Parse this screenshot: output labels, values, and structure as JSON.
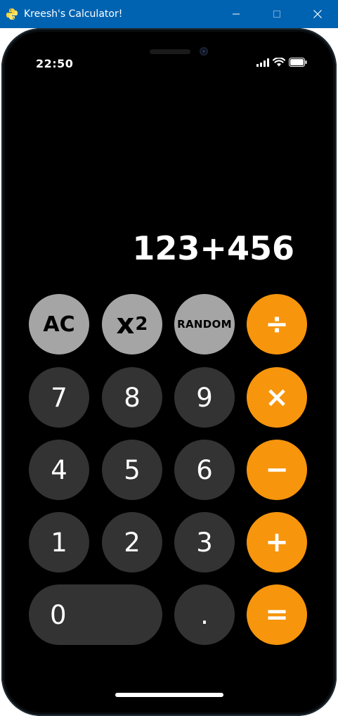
{
  "window": {
    "title": "Kreesh's Calculator!",
    "app_icon": "python-icon",
    "controls": [
      "minimize-icon",
      "maximize-icon",
      "close-icon"
    ]
  },
  "status_bar": {
    "time": "22:50",
    "icons": [
      "signal-icon",
      "wifi-icon",
      "battery-icon"
    ]
  },
  "display": {
    "expression": "123+456"
  },
  "keys": {
    "ac": "AC",
    "square": "x",
    "square_sub": "2",
    "random": "RANDOM",
    "divide": "÷",
    "seven": "7",
    "eight": "8",
    "nine": "9",
    "multiply": "×",
    "four": "4",
    "five": "5",
    "six": "6",
    "minus": "−",
    "one": "1",
    "two": "2",
    "three": "3",
    "plus": "+",
    "zero": "0",
    "decimal": ".",
    "equals": "="
  },
  "colors": {
    "title_bar": "#0063b1",
    "function_key": "#a5a5a5",
    "digit_key": "#333333",
    "operator_key": "#f7950c",
    "background": "#000000"
  }
}
